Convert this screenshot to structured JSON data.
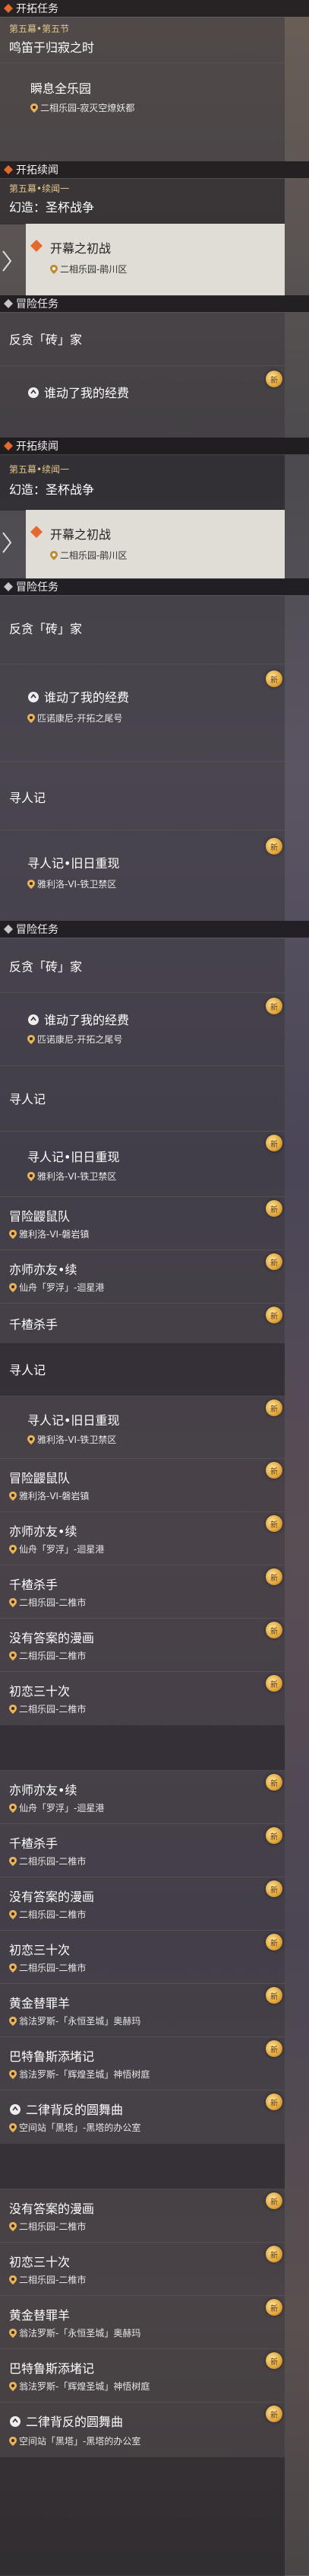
{
  "categories": {
    "trailblaze": "开拓任务",
    "continuation": "开拓续闻",
    "adventure": "冒险任务",
    "wanderer": "寻人记"
  },
  "items": {
    "ch5_sec5_sub": "第五幕•第五节",
    "ch5_sec5_title": "鸣笛于归寂之时",
    "instant_joy_title": "瞬息全乐园",
    "instant_joy_loc": "二相乐园-寂灭空燎妖都",
    "cont1_sub": "第五幕•续闻一",
    "cont1_title": "幻造：圣杯战争",
    "opening_title": "开幕之初战",
    "opening_loc": "二相乐园-鹃川区",
    "brick_title": "反贪「砖」家",
    "funds_title": "谁动了我的经费",
    "funds_loc": "匹诺康尼-开拓之尾号",
    "echo_title": "寻人记•旧日重现",
    "echo_loc": "雅利洛-VI-铁卫禁区",
    "rat_title": "冒险鼹鼠队",
    "rat_loc": "雅利洛-VI-磐岩镇",
    "foe_title": "亦师亦友•续",
    "foe_loc": "仙舟「罗浮」-迴星港",
    "killer_title": "千楂杀手",
    "killer_loc": "二相乐园-二椎市",
    "manga_title": "没有答案的漫画",
    "manga_loc": "二相乐园-二椎市",
    "love_title": "初恋三十次",
    "love_loc": "二相乐园-二椎市",
    "goat_title": "黄金替罪羊",
    "goat_loc": "翁法罗斯-「永恒圣城」奥赫玛",
    "babel_title": "巴特鲁斯添堵记",
    "babel_loc": "翁法罗斯-「辉煌圣城」神悟树庭",
    "dance_title": "二律背反的圆舞曲",
    "dance_loc": "空间站「黑塔」-黑塔的办公室",
    "new_badge": "新"
  },
  "colors": {
    "category_bar": "#141216",
    "highlight_card": "#ece9e2",
    "subtitle_gold": "#e1c48a",
    "accent_orange": "#e36a2c",
    "badge_gold": "#e0a43a"
  }
}
